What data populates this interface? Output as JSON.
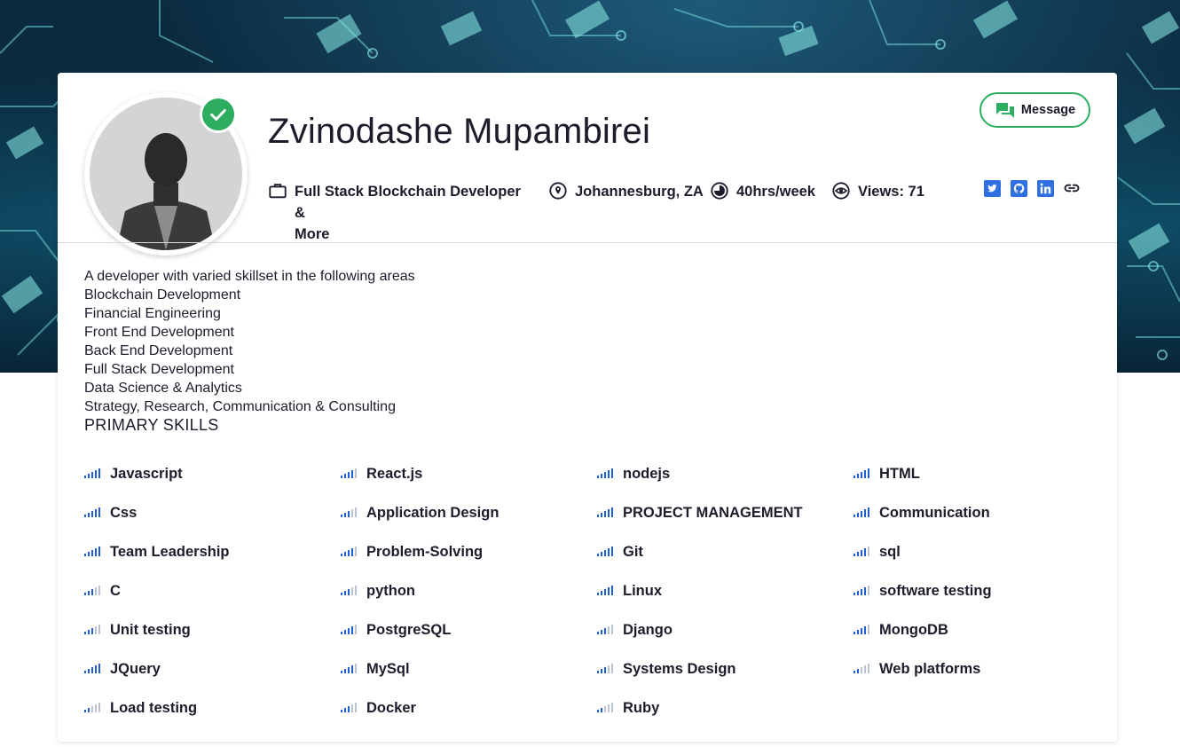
{
  "profile": {
    "name": "Zvinodashe Mupambirei",
    "job_title": [
      "Full Stack Blockchain Developer &",
      "More"
    ],
    "location": "Johannesburg, ZA",
    "availability": "40hrs/week",
    "views": "Views: 71",
    "verified": true
  },
  "actions": {
    "message_label": "Message"
  },
  "socials": [
    {
      "name": "twitter"
    },
    {
      "name": "github"
    },
    {
      "name": "linkedin"
    },
    {
      "name": "website-link"
    }
  ],
  "bio": [
    "A developer with varied skillset in the following areas",
    "Blockchain Development",
    "Financial Engineering",
    "Front End Development",
    "Back End Development",
    "Full Stack Development",
    "Data Science & Analytics",
    "Strategy, Research, Communication & Consulting"
  ],
  "skills_title": "PRIMARY SKILLS",
  "skills": [
    {
      "name": "Javascript",
      "level": 5
    },
    {
      "name": "React.js",
      "level": 4
    },
    {
      "name": "nodejs",
      "level": 5
    },
    {
      "name": "HTML",
      "level": 5
    },
    {
      "name": "Css",
      "level": 5
    },
    {
      "name": "Application Design",
      "level": 3
    },
    {
      "name": "PROJECT MANAGEMENT",
      "level": 5
    },
    {
      "name": "Communication",
      "level": 5
    },
    {
      "name": "Team Leadership",
      "level": 5
    },
    {
      "name": "Problem-Solving",
      "level": 4
    },
    {
      "name": "Git",
      "level": 5
    },
    {
      "name": "sql",
      "level": 4
    },
    {
      "name": "C",
      "level": 3
    },
    {
      "name": "python",
      "level": 3
    },
    {
      "name": "Linux",
      "level": 5
    },
    {
      "name": "software testing",
      "level": 4
    },
    {
      "name": "Unit testing",
      "level": 3
    },
    {
      "name": "PostgreSQL",
      "level": 4
    },
    {
      "name": "Django",
      "level": 3
    },
    {
      "name": "MongoDB",
      "level": 4
    },
    {
      "name": "JQuery",
      "level": 5
    },
    {
      "name": "MySql",
      "level": 4
    },
    {
      "name": "Systems Design",
      "level": 3
    },
    {
      "name": "Web platforms",
      "level": 2
    },
    {
      "name": "Load testing",
      "level": 2
    },
    {
      "name": "Docker",
      "level": 3
    },
    {
      "name": "Ruby",
      "level": 2
    }
  ],
  "colors": {
    "accent_green": "#2dad60",
    "skill_bar_active": "#1f5fd6",
    "skill_bar_inactive": "#b9c3d3",
    "social_blue": "#2f6fe0",
    "text": "#1c1c2b"
  }
}
